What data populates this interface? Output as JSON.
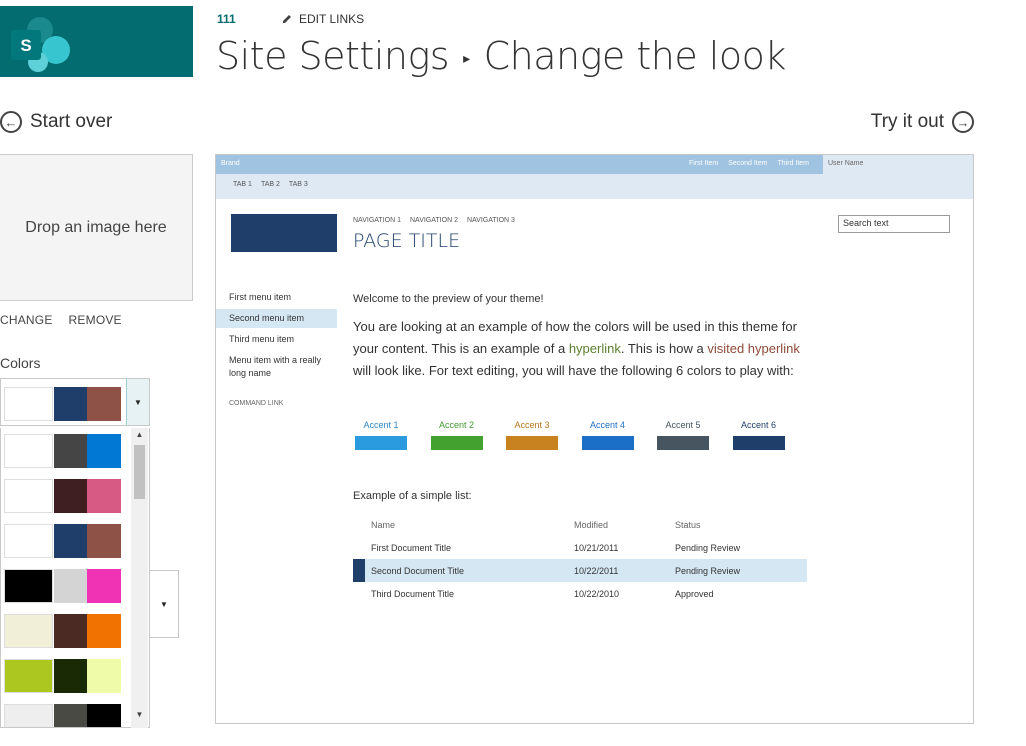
{
  "header": {
    "app_letter": "S",
    "site_number": "111",
    "edit_links_label": "EDIT LINKS",
    "title_parent": "Site Settings",
    "title_separator": "▸",
    "title_current": "Change the look"
  },
  "actions": {
    "start_over": "Start over",
    "try_it_out": "Try it out"
  },
  "left_pane": {
    "drop_zone_text": "Drop an image here",
    "change_label": "CHANGE",
    "remove_label": "REMOVE",
    "colors_label": "Colors",
    "selected_palette": [
      "#ffffff",
      "#1f3f6a",
      "#8f5247"
    ],
    "palettes": [
      [
        "#ffffff",
        "#454545",
        "#0078d4"
      ],
      [
        "#ffffff",
        "#3f1f22",
        "#d65a84"
      ],
      [
        "#ffffff",
        "#1f3f6a",
        "#8f5247"
      ],
      [
        "#000000",
        "#d4d4d4",
        "#f032b4"
      ],
      [
        "#f2efd8",
        "#4a2a22",
        "#f27200"
      ],
      [
        "#acc820",
        "#1a2a05",
        "#f0fbaa"
      ],
      [
        "#eeeeee",
        "#4a4a44",
        "#000000"
      ]
    ]
  },
  "preview": {
    "brand": "Brand",
    "top_nav": [
      "First Item",
      "Second Item",
      "Third Item"
    ],
    "user_name": "User Name",
    "tabs": [
      "TAB 1",
      "TAB 2",
      "TAB 3"
    ],
    "nav": [
      "NAVIGATION 1",
      "NAVIGATION 2",
      "NAVIGATION 3"
    ],
    "page_title": "PAGE TITLE",
    "search_placeholder": "Search text",
    "menu": [
      "First menu item",
      "Second menu item",
      "Third menu item",
      "Menu item with a really long name"
    ],
    "selected_menu_index": 1,
    "command_link": "COMMAND LINK",
    "welcome": "Welcome to the preview of your theme!",
    "body_part1": "You are looking at an example of how the colors will be used in this theme for your content. This is an example of a ",
    "hyperlink": "hyperlink",
    "body_part2": ". This is how a ",
    "visited_hyperlink": "visited hyperlink",
    "body_part3": " will look like. For text editing, you will have the following 6 colors to play with:",
    "accents": [
      {
        "label": "Accent 1",
        "color": "#2b9be0",
        "label_color": "#2b88c8"
      },
      {
        "label": "Accent 2",
        "color": "#43a12f",
        "label_color": "#3f9a2c"
      },
      {
        "label": "Accent 3",
        "color": "#c8821f",
        "label_color": "#b8751a"
      },
      {
        "label": "Accent 4",
        "color": "#1c6fc6",
        "label_color": "#1c6fc6"
      },
      {
        "label": "Accent 5",
        "color": "#46555f",
        "label_color": "#46555f"
      },
      {
        "label": "Accent 6",
        "color": "#1f3f6a",
        "label_color": "#1f3f6a"
      }
    ],
    "list_title": "Example of a simple list:",
    "list_headers": [
      "Name",
      "Modified",
      "Status"
    ],
    "list_rows": [
      [
        "First Document Title",
        "10/21/2011",
        "Pending Review"
      ],
      [
        "Second Document Title",
        "10/22/2011",
        "Pending Review"
      ],
      [
        "Third Document Title",
        "10/22/2010",
        "Approved"
      ]
    ],
    "selected_row_index": 1
  }
}
